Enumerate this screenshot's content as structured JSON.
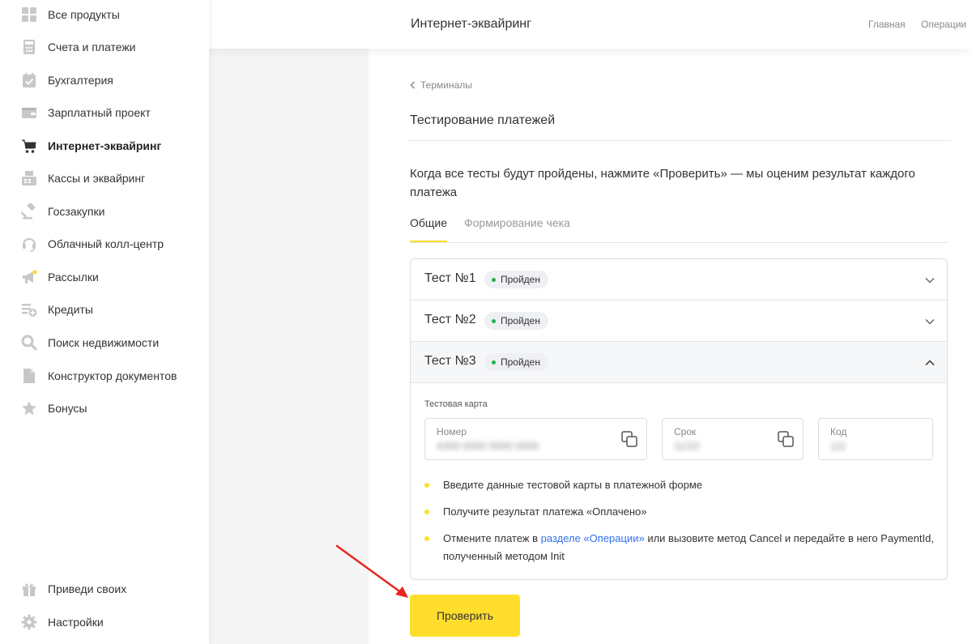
{
  "sidebar": {
    "items": [
      {
        "label": "Все продукты",
        "icon": "grid-icon"
      },
      {
        "label": "Счета и платежи",
        "icon": "calculator-icon"
      },
      {
        "label": "Бухгалтерия",
        "icon": "calendar-check-icon"
      },
      {
        "label": "Зарплатный проект",
        "icon": "wallet-icon"
      },
      {
        "label": "Интернет-эквайринг",
        "icon": "cart-icon",
        "active": true
      },
      {
        "label": "Кассы и эквайринг",
        "icon": "cash-register-icon"
      },
      {
        "label": "Госзакупки",
        "icon": "gavel-icon"
      },
      {
        "label": "Облачный колл-центр",
        "icon": "headset-icon"
      },
      {
        "label": "Рассылки",
        "icon": "megaphone-icon"
      },
      {
        "label": "Кредиты",
        "icon": "credit-list-icon"
      },
      {
        "label": "Поиск недвижимости",
        "icon": "search-icon"
      },
      {
        "label": "Конструктор документов",
        "icon": "document-icon"
      },
      {
        "label": "Бонусы",
        "icon": "star-icon"
      }
    ],
    "bottom_items": [
      {
        "label": "Приведи своих",
        "icon": "gift-icon"
      },
      {
        "label": "Настройки",
        "icon": "gear-icon"
      }
    ]
  },
  "header": {
    "title": "Интернет-эквайринг",
    "links": [
      "Главная",
      "Операции"
    ]
  },
  "page": {
    "back_label": "Терминалы",
    "title": "Тестирование платежей",
    "description": "Когда все тесты будут пройдены, нажмите «Проверить» — мы оценим результат каждого платежа",
    "tabs": [
      "Общие",
      "Формирование чека"
    ],
    "active_tab": "Общие"
  },
  "tests": [
    {
      "name": "Тест №1",
      "status": "Пройден",
      "expanded": false
    },
    {
      "name": "Тест №2",
      "status": "Пройден",
      "expanded": false
    },
    {
      "name": "Тест №3",
      "status": "Пройден",
      "expanded": true
    }
  ],
  "test_card": {
    "label": "Тестовая карта",
    "fields": [
      {
        "label": "Номер",
        "value": "4300 0000 0000 0000"
      },
      {
        "label": "Срок",
        "value": "11/22"
      },
      {
        "label": "Код",
        "value": "111"
      }
    ]
  },
  "steps": {
    "s1": "Введите данные тестовой карты в платежной форме",
    "s2": "Получите результат платежа «Оплачено»",
    "s3_before": "Отмените платеж в ",
    "s3_link": "разделе «Операции»",
    "s3_after": " или вызовите метод Cancel и передайте в него PaymentId, полученный методом Init"
  },
  "actions": {
    "check_label": "Проверить"
  },
  "colors": {
    "accent": "#ffdd2d",
    "link": "#336fee",
    "status_ok": "#1fb350",
    "annotation_arrow": "#e8251f"
  }
}
